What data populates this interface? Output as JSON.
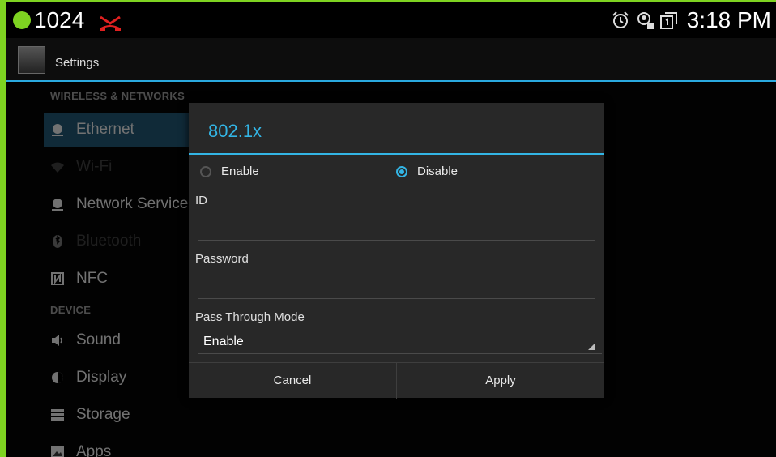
{
  "status_bar": {
    "extension": "1024",
    "time": "3:18 PM",
    "icons": [
      "alarm-icon",
      "account-icon",
      "display-icon"
    ]
  },
  "action_bar": {
    "title": "Settings"
  },
  "settings_list": {
    "sections": [
      "WIRELESS & NETWORKS",
      "DEVICE"
    ],
    "items": [
      {
        "label": "Ethernet",
        "icon": "ethernet-icon",
        "active": true
      },
      {
        "label": "Wi-Fi",
        "icon": "wifi-icon",
        "active": false
      },
      {
        "label": "Network Service",
        "icon": "network-icon",
        "active": false
      },
      {
        "label": "Bluetooth",
        "icon": "bluetooth-icon",
        "active": false
      },
      {
        "label": "NFC",
        "icon": "nfc-icon",
        "active": false
      },
      {
        "label": "Sound",
        "icon": "sound-icon",
        "active": false
      },
      {
        "label": "Display",
        "icon": "display-icon",
        "active": false
      },
      {
        "label": "Storage",
        "icon": "storage-icon",
        "active": false
      },
      {
        "label": "Apps",
        "icon": "apps-icon",
        "active": false
      }
    ]
  },
  "dialog": {
    "title": "802.1x",
    "radio_enable": "Enable",
    "radio_disable": "Disable",
    "selected": "Disable",
    "id_label": "ID",
    "id_value": "",
    "password_label": "Password",
    "password_value": "",
    "pass_through_label": "Pass Through Mode",
    "pass_through_value": "Enable",
    "cancel": "Cancel",
    "apply": "Apply"
  },
  "colors": {
    "accent": "#33b5e5",
    "status_green": "#7ed321",
    "call_red": "#e02020"
  }
}
